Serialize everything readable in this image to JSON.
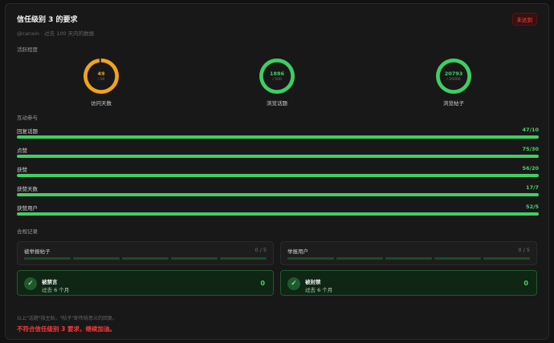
{
  "header": {
    "title": "信任级别 3 的要求",
    "badge": "未达到",
    "subtitle": "@canxin · 过去 100 天内的数据"
  },
  "activity": {
    "section_label": "活跃程度",
    "gauges": [
      {
        "value": "49",
        "max": "/ 50",
        "label": "访问天数",
        "progress": 0.98,
        "color": "#f2a31b"
      },
      {
        "value": "1886",
        "max": "/ 500",
        "label": "浏览话题",
        "progress": 1.0,
        "color": "#3ecf63"
      },
      {
        "value": "20793",
        "max": "/ 20000",
        "label": "浏览帖子",
        "progress": 1.0,
        "color": "#3ecf63"
      }
    ]
  },
  "interaction": {
    "section_label": "互动参与",
    "bars": [
      {
        "label": "回复话题",
        "value": "47/10",
        "progress": 1.0
      },
      {
        "label": "点赞",
        "value": "75/30",
        "progress": 1.0
      },
      {
        "label": "获赞",
        "value": "56/20",
        "progress": 1.0
      },
      {
        "label": "获赞天数",
        "value": "17/7",
        "progress": 1.0
      },
      {
        "label": "获赞用户",
        "value": "52/5",
        "progress": 1.0
      }
    ]
  },
  "compliance": {
    "section_label": "合规记录",
    "reports": [
      {
        "label": "被举报帖子",
        "value": "0 / 5",
        "segments": 5
      },
      {
        "label": "举报用户",
        "value": "0 / 5",
        "segments": 5
      }
    ],
    "penalties": [
      {
        "title": "被禁言",
        "sub": "过去 6 个月",
        "value": "0"
      },
      {
        "title": "被封禁",
        "sub": "过去 6 个月",
        "value": "0"
      }
    ]
  },
  "footer": {
    "note": "以上\"话题\"指主贴，\"帖子\"即传统意义的回复。",
    "result": "不符合信任级别 3 要求，继续加油。"
  },
  "colors": {
    "accent": "#3ecf63",
    "warning": "#f2a31b",
    "danger": "#ff3b3b"
  }
}
